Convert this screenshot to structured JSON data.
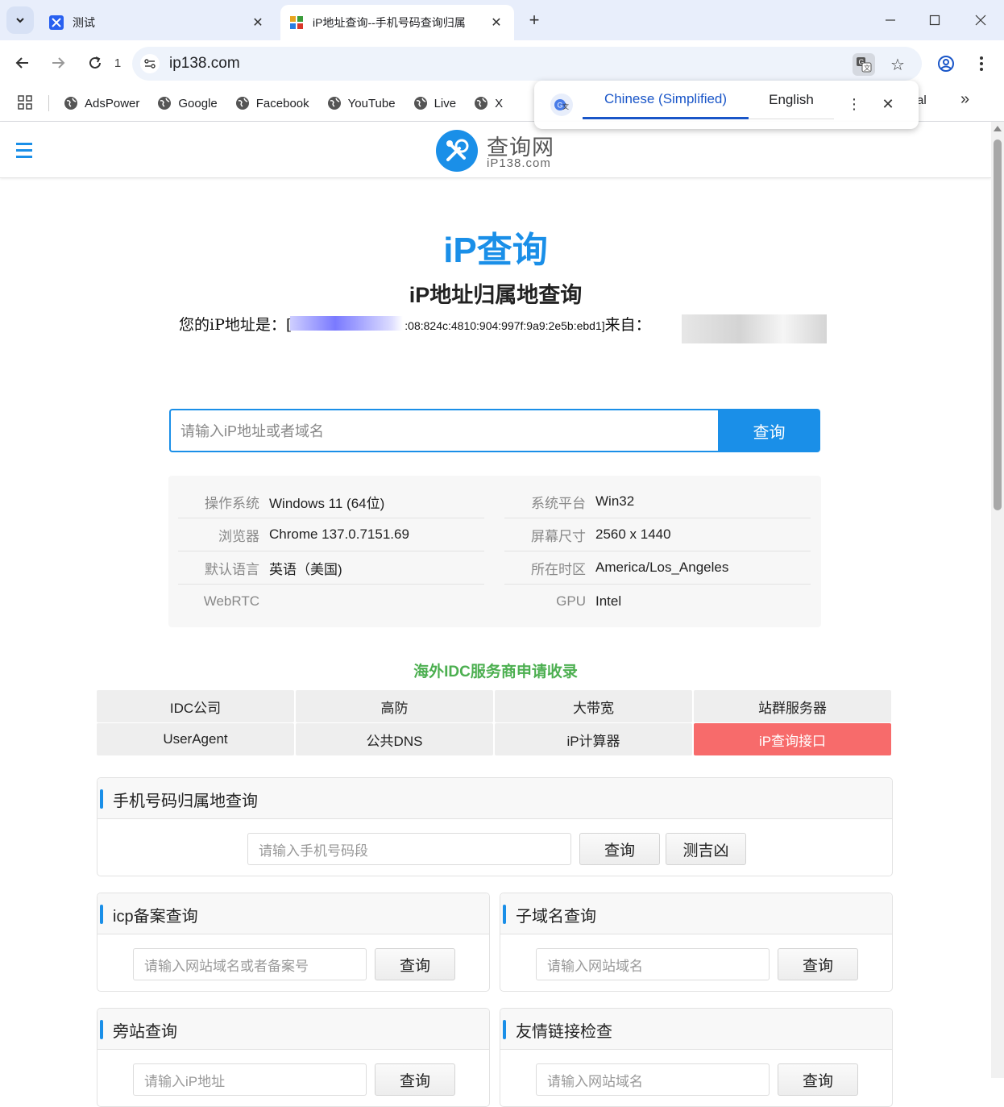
{
  "browser": {
    "tabs": [
      {
        "title": "测试"
      },
      {
        "title": "iP地址查询--手机号码查询归属"
      }
    ],
    "reload_count": "1",
    "url": "ip138.com",
    "bookmarks": [
      "AdsPower",
      "Google",
      "Facebook",
      "YouTube",
      "Live",
      "X"
    ],
    "bookmark_overflow_text": "al",
    "overflow_label": "»"
  },
  "translate": {
    "lang_source": "Chinese (Simplified)",
    "lang_target": "English"
  },
  "site": {
    "logo_cn": "查询网",
    "logo_en": "iP138.com",
    "hero_title": "iP查询",
    "hero_subtitle": "iP地址归属地查询",
    "ip_prefix": "您的iP地址是：[",
    "ip_value": ":08:824c:4810:904:997f:9a9:2e5b:ebd1]",
    "ip_from": "来自："
  },
  "search": {
    "placeholder": "请输入iP地址或者域名",
    "button": "查询"
  },
  "info": [
    {
      "k": "操作系统",
      "v": "Windows 11 (64位)"
    },
    {
      "k": "系统平台",
      "v": "Win32"
    },
    {
      "k": "浏览器",
      "v": "Chrome 137.0.7151.69"
    },
    {
      "k": "屏幕尺寸",
      "v": "2560 x 1440"
    },
    {
      "k": "默认语言",
      "v": "英语（美国)"
    },
    {
      "k": "所在时区",
      "v": "America/Los_Angeles"
    },
    {
      "k": "WebRTC",
      "v": ""
    },
    {
      "k": "GPU",
      "v": "Intel"
    }
  ],
  "idc": {
    "title": "海外IDC服务商申请收录",
    "items": [
      "IDC公司",
      "高防",
      "大带宽",
      "站群服务器",
      "UserAgent",
      "公共DNS",
      "iP计算器",
      "iP查询接口"
    ],
    "highlight_color": "#f76b6b"
  },
  "panels": {
    "phone": {
      "title": "手机号码归属地查询",
      "placeholder": "请输入手机号码段",
      "btn1": "查询",
      "btn2": "测吉凶"
    },
    "icp": {
      "title": "icp备案查询",
      "placeholder": "请输入网站域名或者备案号",
      "btn": "查询"
    },
    "subdomain": {
      "title": "子域名查询",
      "placeholder": "请输入网站域名",
      "btn": "查询"
    },
    "sibling": {
      "title": "旁站查询",
      "placeholder": "请输入iP地址",
      "btn": "查询"
    },
    "friendlink": {
      "title": "友情链接检查",
      "placeholder": "请输入网站域名",
      "btn": "查询"
    }
  },
  "colors": {
    "accent": "#1a8fe8",
    "green": "#4caf50"
  }
}
